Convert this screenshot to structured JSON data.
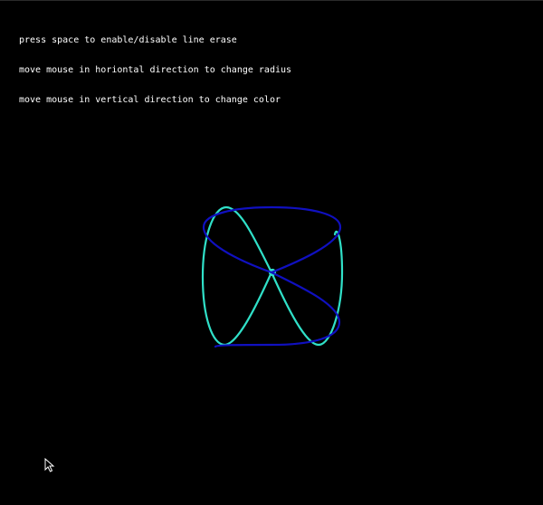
{
  "instructions": [
    "press space to enable/disable line erase",
    "move mouse in horiontal direction to change radius",
    "move mouse in vertical direction to change color"
  ],
  "colors": {
    "background": "#000000",
    "text": "#ffffff",
    "curve_cyan": "#30e0c8",
    "curve_blue": "#1010c0",
    "cursor_fill": "#000000",
    "cursor_stroke": "#ffffff"
  },
  "icons": {
    "pointer": "mouse-pointer-icon"
  }
}
